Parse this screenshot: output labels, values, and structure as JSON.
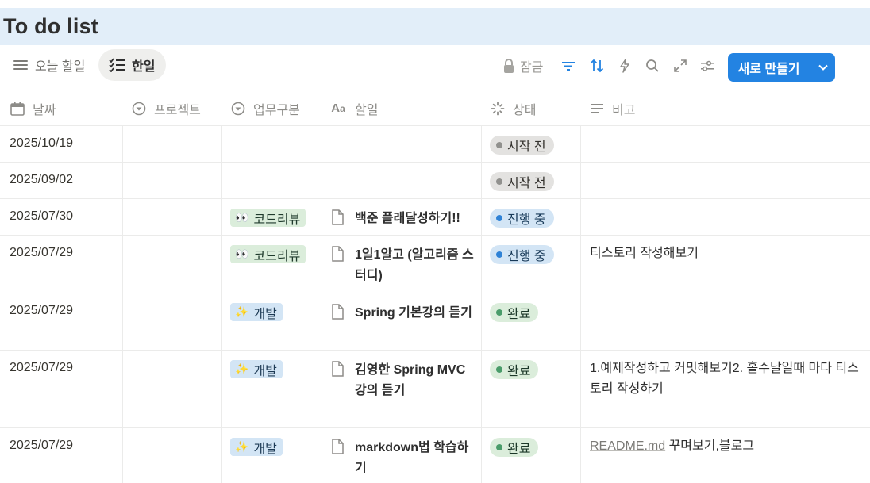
{
  "page": {
    "title": "To do list"
  },
  "views": [
    {
      "label": "오늘 할일",
      "icon": "list-icon",
      "active": false
    },
    {
      "label": "한일",
      "icon": "checklist-icon",
      "active": true
    }
  ],
  "toolbar": {
    "lock_label": "잠금",
    "new_label": "새로 만들기",
    "accent": "#2383e2"
  },
  "columns": [
    {
      "label": "날짜",
      "icon": "calendar-icon"
    },
    {
      "label": "프로젝트",
      "icon": "select-icon"
    },
    {
      "label": "업무구분",
      "icon": "select-icon"
    },
    {
      "label": "할일",
      "icon": "text-aa-icon"
    },
    {
      "label": "상태",
      "icon": "status-spinner-icon"
    },
    {
      "label": "비고",
      "icon": "text-lines-icon"
    }
  ],
  "rows": [
    {
      "date": "2025/10/19",
      "project": "",
      "category": "",
      "task": "",
      "status": "시작 전",
      "note": ""
    },
    {
      "date": "2025/09/02",
      "project": "",
      "category": "",
      "task": "",
      "status": "시작 전",
      "note": ""
    },
    {
      "date": "2025/07/30",
      "project": "",
      "category": "코드리뷰",
      "task": "백준 플래달성하기!!",
      "status": "진행 중",
      "note": ""
    },
    {
      "date": "2025/07/29",
      "project": "",
      "category": "코드리뷰",
      "task": "1일1알고 (알고리즘 스터디)",
      "status": "진행 중",
      "note": "티스토리 작성해보기"
    },
    {
      "date": "2025/07/29",
      "project": "",
      "category": "개발",
      "task": "Spring 기본강의 듣기",
      "status": "완료",
      "note": ""
    },
    {
      "date": "2025/07/29",
      "project": "",
      "category": "개발",
      "task": "김영한 Spring MVC 강의 듣기",
      "status": "완료",
      "note": "1.예제작성하고 커밋해보기2. 홀수날일때 마다 티스토리 작성하기"
    },
    {
      "date": "2025/07/29",
      "project": "",
      "category": "개발",
      "task": "markdown법 학습하기",
      "status": "완료",
      "note_link": "README.md",
      "note": " 꾸며보기,블로그"
    }
  ],
  "category_emoji": {
    "코드리뷰": "👀",
    "개발": "✨"
  },
  "status_colors": {
    "시작 전": "#91918e",
    "진행 중": "#2f82d6",
    "완료": "#4a9c6a"
  }
}
